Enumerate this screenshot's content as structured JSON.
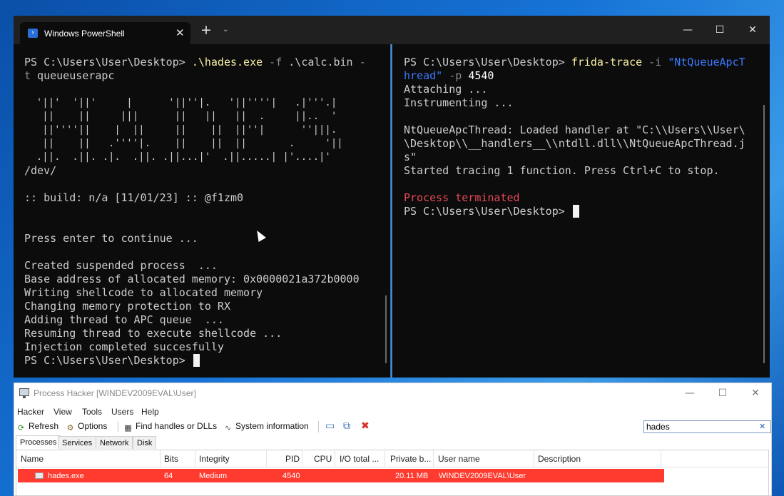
{
  "terminal": {
    "tab_title": "Windows PowerShell",
    "tab_close": "✕",
    "new_tab": "+",
    "tab_dropdown": "⌄",
    "minimize": "—",
    "maximize": "☐",
    "close": "✕",
    "left_pane": {
      "cmd_prompt": "PS C:\\Users\\User\\Desktop> ",
      "cmd_exe": ".\\hades.exe",
      "cmd_flag_f": " -f",
      "cmd_file": " .\\calc.bin ",
      "cmd_flag_t_start": "-",
      "cmd_flag_t_end": "t",
      "cmd_technique": " queueuserapc",
      "ascii_art": [
        "  '||'  '||'     |      '||''|.   '||''''|   .|'''.|",
        "   ||    ||     |||      ||   ||   ||  .     ||..  '",
        "   ||''''||    |  ||     ||    ||  ||''|      ''|||.",
        "   ||    ||   .''''|.    ||    ||  ||       .     '||",
        "  .||.  .||. .|.  .||. .||...|'  .||.....| |'....|'"
      ],
      "ascii_tag": "/dev/",
      "build_line": ":: build: n/a [11/01/23] :: @f1zm0",
      "press_enter": "Press enter to continue ...",
      "output": [
        "Created suspended process  ...",
        "Base address of allocated memory: 0x0000021a372b0000",
        "Writing shellcode to allocated memory",
        "Changing memory protection to RX",
        "Adding thread to APC queue  ...",
        "Resuming thread to execute shellcode ...",
        "Injection completed succesfully"
      ],
      "final_prompt": "PS C:\\Users\\User\\Desktop> "
    },
    "right_pane": {
      "cmd_prompt": "PS C:\\Users\\User\\Desktop> ",
      "cmd_exe": "frida-trace",
      "cmd_flag_i": " -i ",
      "cmd_str_part1": "\"NtQueueApcT",
      "cmd_str_part2": "hread\"",
      "cmd_flag_p": " -p ",
      "cmd_pid": "4540",
      "attaching": "Attaching ...",
      "instrumenting": "Instrumenting ...",
      "handler_lines": [
        "NtQueueApcThread: Loaded handler at \"C:\\\\Users\\\\User\\",
        "\\Desktop\\\\__handlers__\\\\ntdll.dll\\\\NtQueueApcThread.j",
        "s\""
      ],
      "started": "Started tracing 1 function. Press Ctrl+C to stop.",
      "terminated": "Process terminated",
      "final_prompt": "PS C:\\Users\\User\\Desktop> "
    }
  },
  "process_hacker": {
    "title": "Process Hacker [WINDEV2009EVAL\\User]",
    "minimize": "—",
    "maximize": "☐",
    "close": "✕",
    "menu": [
      "Hacker",
      "View",
      "Tools",
      "Users",
      "Help"
    ],
    "toolbar": {
      "refresh": "Refresh",
      "options": "Options",
      "find_handles": "Find handles or DLLs",
      "system_info": "System information"
    },
    "search_value": "hades",
    "search_clear": "✕",
    "tabs": [
      "Processes",
      "Services",
      "Network",
      "Disk"
    ],
    "columns": [
      "Name",
      "Bits",
      "Integrity",
      "PID",
      "CPU",
      "I/O total ...",
      "Private b...",
      "User name",
      "Description"
    ],
    "row": {
      "name": "hades.exe",
      "bits": "64",
      "integrity": "Medium",
      "pid": "4540",
      "cpu": "",
      "io": "",
      "private": "20.11 MB",
      "user": "WINDEV2009EVAL\\User",
      "description": ""
    },
    "row_highlight_color": "#ff3b2f"
  }
}
